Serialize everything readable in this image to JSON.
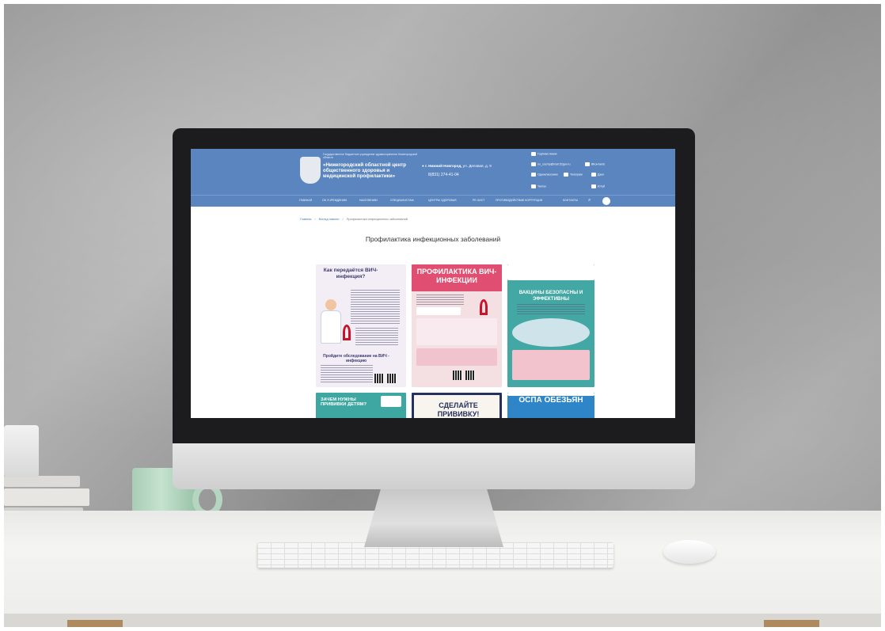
{
  "site": {
    "org_small": "Государственное бюджетное учреждение здравоохранения Нижегородской области",
    "org_name": "«Нижегородский областной центр общественного здоровья и медицинской профилактики»",
    "address_city": "г. Нижний Новгород,",
    "address_street": "ул. Деловая, д. 9",
    "phone": "8(831) 274-41-04",
    "contacts": {
      "hotline": "Горячая линия",
      "email": "no_cozmp@mail.52gov.ru",
      "vk": "ВКонтакте",
      "ok": "Одноклассники",
      "telegram": "Телеграм",
      "dzen": "Дзен",
      "tiktok": "Тикток",
      "youtube": "Ютуб"
    }
  },
  "nav": {
    "items": [
      "ГЛАВНАЯ",
      "ОБ УЧРЕЖДЕНИИ",
      "НАСЕЛЕНИЮ",
      "СПЕЦИАЛИСТАМ",
      "ЦЕНТРЫ ЗДОРОВЬЯ",
      "РЕ-ЧИСТ",
      "ПРОТИВОДЕЙСТВИЕ КОРРУПЦИИ",
      "КОНТАКТЫ"
    ],
    "search_icon": "search-icon",
    "accessibility_icon": "eye-icon"
  },
  "breadcrumb": {
    "home": "Главная",
    "section": "Взгляд памяти",
    "current": "Профилактика инфекционных заболеваний",
    "separator": "/"
  },
  "page": {
    "title": "Профилактика инфекционных заболеваний"
  },
  "posters": [
    {
      "title": "Как передаётся ВИЧ-инфекция?",
      "subtitle": "Пройдите обследование на ВИЧ - инфекцию"
    },
    {
      "title": "ПРОФИЛАКТИКА ВИЧ-ИНФЕКЦИИ"
    },
    {
      "title": "ВАКЦИНЫ БЕЗОПАСНЫ И ЭФФЕКТИВНЫ"
    },
    {
      "title": "ЗАЧЕМ НУЖНЫ ПРИВИВКИ ДЕТЯМ?"
    },
    {
      "title": "СДЕЛАЙТЕ ПРИВИВКУ!"
    },
    {
      "title": "ОСПА ОБЕЗЬЯН"
    }
  ],
  "colors": {
    "header_blue": "#5b85bf",
    "hiv_pink": "#e04f72",
    "vaccine_teal": "#43a7a4",
    "ribbon_red": "#c8142b"
  }
}
